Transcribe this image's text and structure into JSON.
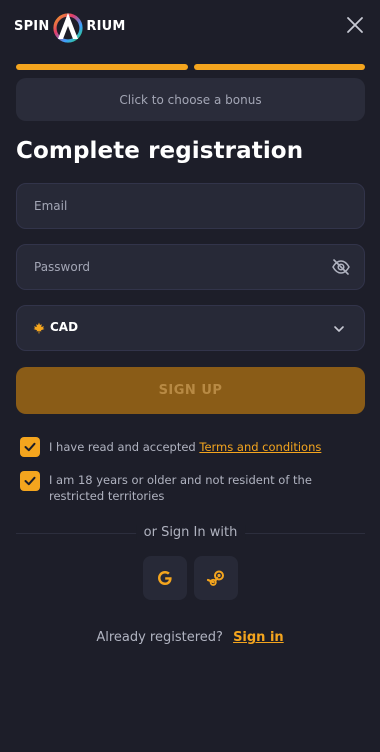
{
  "brand": {
    "name_left": "SPIN",
    "name_right": "RIUM",
    "accent": "#f4a51e"
  },
  "header": {
    "close_icon": "close-icon"
  },
  "progress": {
    "steps_total": 2,
    "steps_complete": 2
  },
  "bonus": {
    "label": "Click to choose a bonus"
  },
  "form": {
    "title": "Complete registration",
    "email_placeholder": "Email",
    "email_value": "",
    "password_placeholder": "Password",
    "password_value": "",
    "password_toggle_icon": "eye-off-icon",
    "currency": {
      "selected": "CAD",
      "icon": "maple-leaf-icon"
    },
    "submit_label": "SIGN UP"
  },
  "consents": [
    {
      "checked": true,
      "text": "I have read and accepted ",
      "link_text": "Terms and conditions"
    },
    {
      "checked": true,
      "text": "I am 18 years or older and not resident of the restricted territories"
    }
  ],
  "social": {
    "divider_text": "or Sign In with",
    "providers": [
      "google",
      "steam"
    ]
  },
  "footer": {
    "prompt": "Already registered?",
    "link_text": "Sign in"
  }
}
